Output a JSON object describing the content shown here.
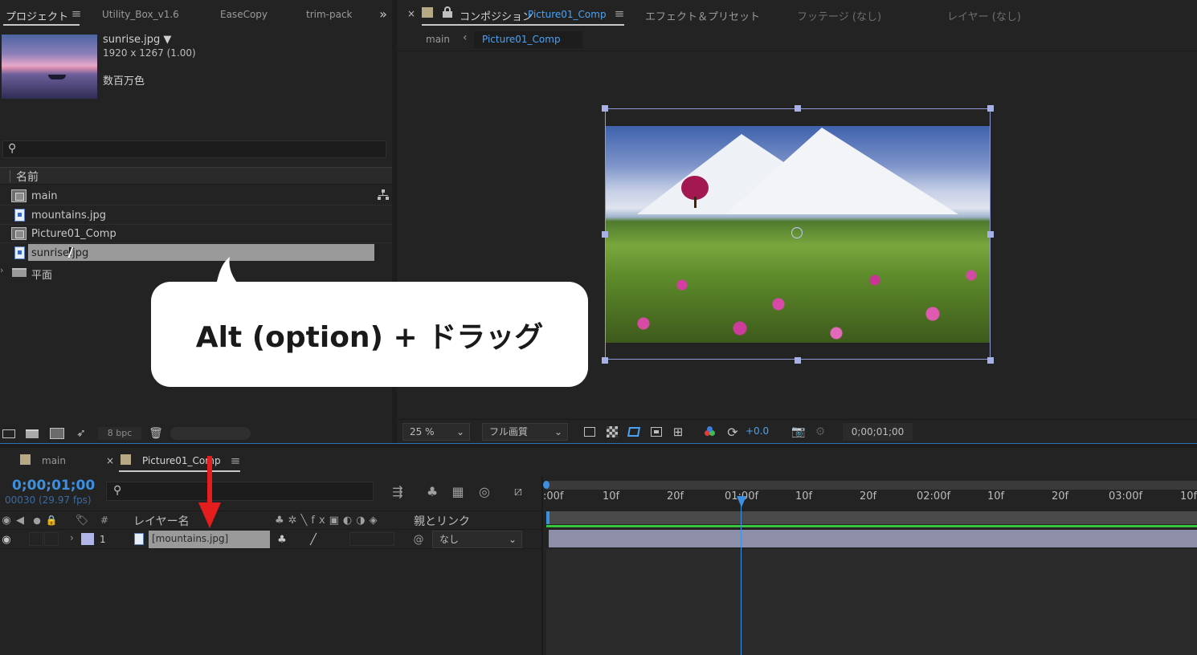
{
  "project_panel": {
    "tabs": [
      "プロジェクト",
      "Utility_Box_v1.6",
      "EaseCopy",
      "trim-pack"
    ],
    "thumb_name": "sunrise.jpg ▼",
    "thumb_info": "1920 x 1267 (1.00)",
    "thumb_colors": "数百万色",
    "search_placeholder": "",
    "column_name": "名前",
    "items": [
      {
        "label": "main",
        "type": "comp"
      },
      {
        "label": "mountains.jpg",
        "type": "file"
      },
      {
        "label": "Picture01_Comp",
        "type": "comp"
      },
      {
        "label": "sunrise.jpg",
        "type": "file",
        "selected": true
      },
      {
        "label": "平面",
        "type": "folder"
      }
    ],
    "bpc": "8 bpc"
  },
  "callout": {
    "text": "Alt (option) + ドラッグ"
  },
  "comp_panel": {
    "close": "×",
    "tab_prefix": "コンポジション",
    "tab_name": "Picture01_Comp",
    "other_tabs": [
      "エフェクト＆プリセット",
      "フッテージ (なし)",
      "レイヤー (なし)"
    ],
    "breadcrumb": [
      "main",
      "Picture01_Comp"
    ],
    "zoom": "25 %",
    "quality": "フル画質",
    "exposure": "+0.0",
    "timecode": "0;00;01;00"
  },
  "timeline": {
    "tabs": [
      "main",
      "Picture01_Comp"
    ],
    "timecode": "0;00;01;00",
    "frame_info": "00030 (29.97 fps)",
    "col_hash": "#",
    "col_layer_name": "レイヤー名",
    "col_parent": "親とリンク",
    "layer": {
      "index": "1",
      "name": "[mountains.jpg]",
      "parent": "なし"
    },
    "ruler": [
      ":00f",
      "10f",
      "20f",
      "01:00f",
      "10f",
      "20f",
      "02:00f",
      "10f",
      "20f",
      "03:00f",
      "10f"
    ]
  },
  "colors": {
    "accent": "#2d8ceb",
    "selected_row": "#9a9a9a",
    "label_swatch": "#b0b4e6"
  }
}
